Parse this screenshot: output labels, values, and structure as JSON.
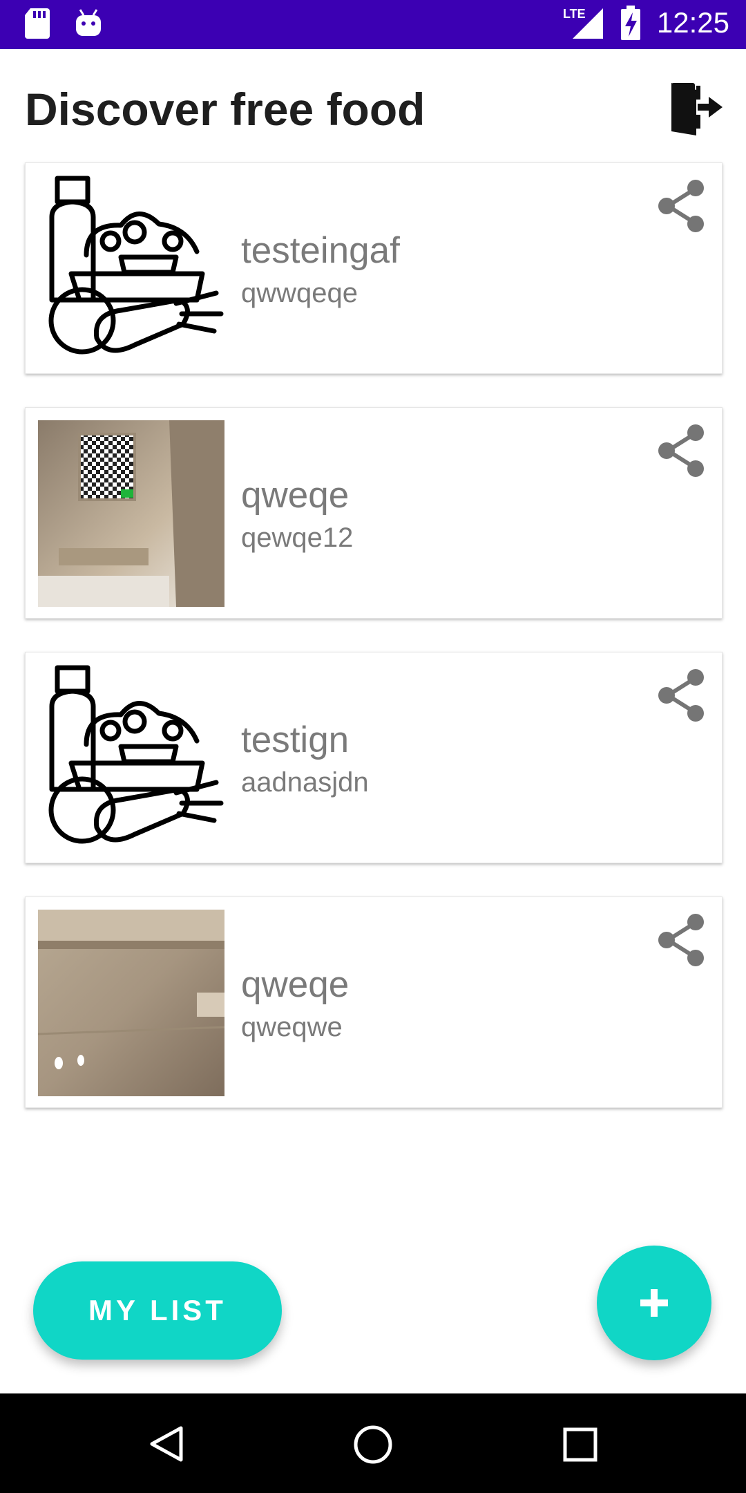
{
  "status_bar": {
    "time": "12:25",
    "network": "LTE",
    "background_color": "#3c00b3",
    "icons": [
      "sd-card-icon",
      "android-icon",
      "signal-icon",
      "battery-charging-icon"
    ]
  },
  "header": {
    "title": "Discover free food",
    "exit_icon": "exit-door-icon"
  },
  "listings": [
    {
      "title": "testeingaf",
      "subtitle": "qwwqeqe",
      "image": "food-basket-icon"
    },
    {
      "title": "qweqe",
      "subtitle": "qewqe12",
      "image": "photo-ceiling"
    },
    {
      "title": "testign",
      "subtitle": "aadnasjdn",
      "image": "food-basket-icon"
    },
    {
      "title": "qweqe",
      "subtitle": "qweqwe",
      "image": "photo-room"
    }
  ],
  "actions": {
    "my_list_label": "MY LIST",
    "add_icon": "plus-icon",
    "accent_color": "#10d6c6"
  },
  "nav": {
    "icons": [
      "back-triangle-icon",
      "home-circle-icon",
      "recents-square-icon"
    ]
  }
}
